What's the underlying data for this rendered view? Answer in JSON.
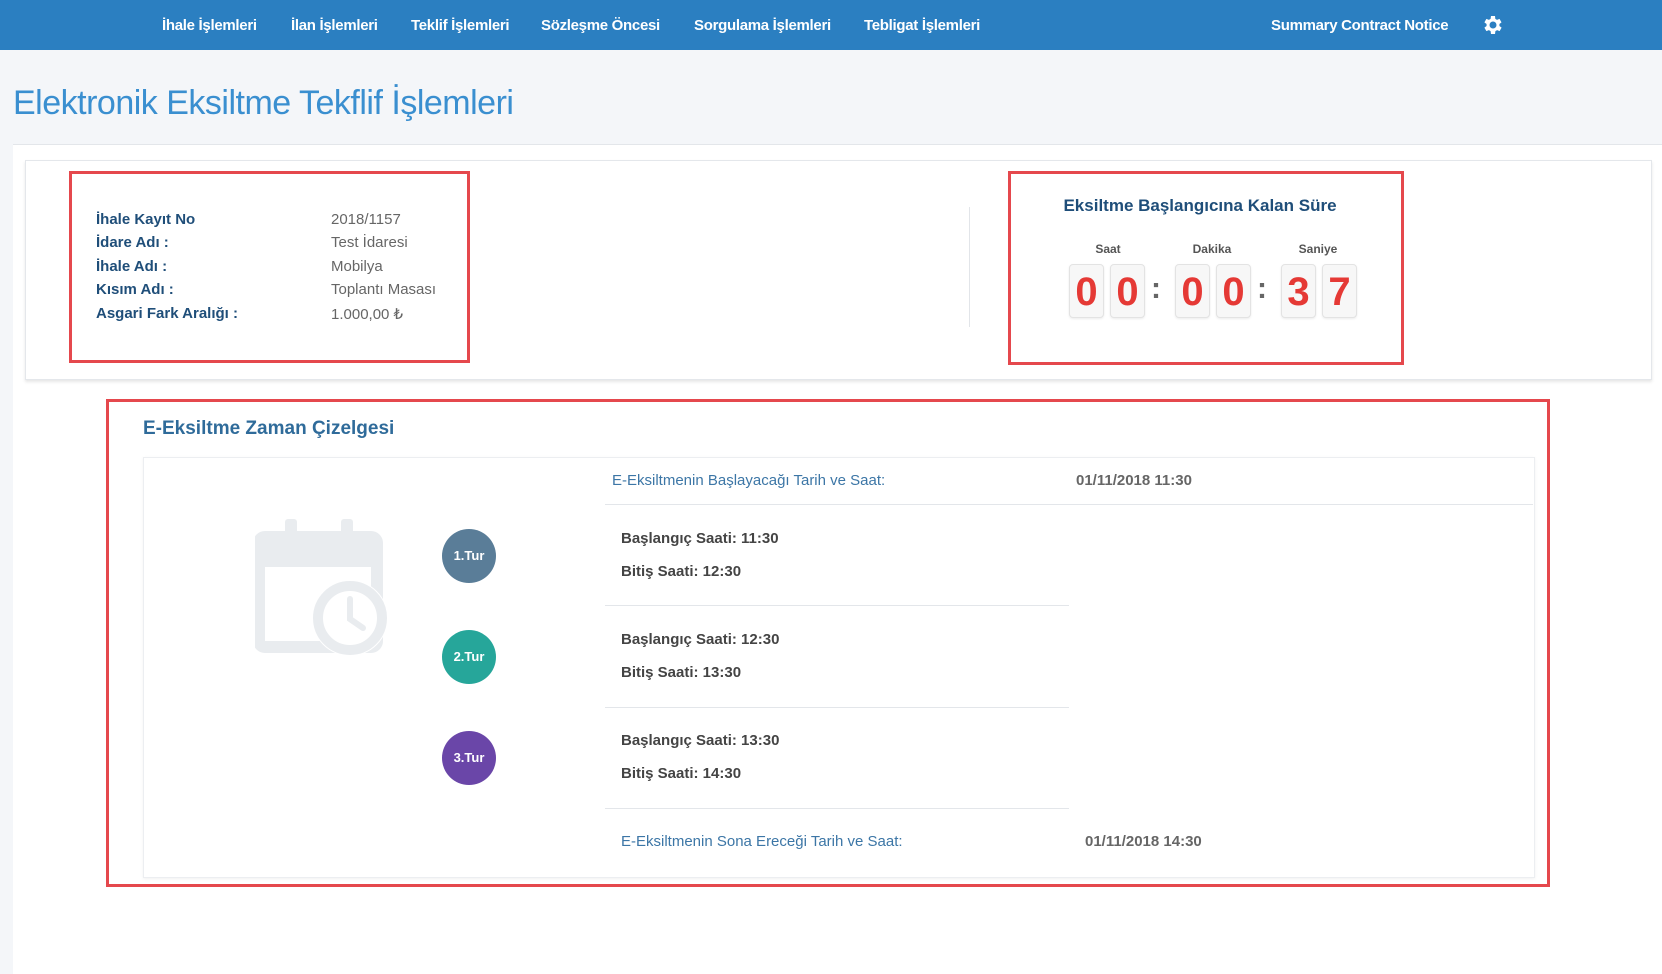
{
  "nav": {
    "items": [
      "İhale İşlemleri",
      "İlan İşlemleri",
      "Teklif İşlemleri",
      "Sözleşme Öncesi",
      "Sorgulama İşlemleri",
      "Tebligat İşlemleri"
    ],
    "right_link": "Summary Contract Notice",
    "settings_icon": "gear-icon"
  },
  "page": {
    "title": "Elektronik Eksiltme Tekflif İşlemleri"
  },
  "info": {
    "rows": [
      {
        "label": "İhale Kayıt No",
        "value": "2018/1157"
      },
      {
        "label": "İdare Adı :",
        "value": "Test İdaresi"
      },
      {
        "label": "İhale Adı :",
        "value": "Mobilya"
      },
      {
        "label": "Kısım Adı :",
        "value": "Toplantı Masası"
      },
      {
        "label": "Asgari Fark Aralığı :",
        "value": "1.000,00 ₺"
      }
    ]
  },
  "countdown": {
    "title": "Eksiltme Başlangıcına Kalan Süre",
    "labels": [
      "Saat",
      "Dakika",
      "Saniye"
    ],
    "digits": [
      "0",
      "0",
      "0",
      "0",
      "3",
      "7"
    ]
  },
  "timeline": {
    "title": "E-Eksiltme Zaman Çizelgesi",
    "start_label": "E-Eksiltmenin Başlayacağı Tarih ve Saat:",
    "start_value": "01/11/2018 11:30",
    "rounds": [
      {
        "badge": "1.Tur",
        "start": "Başlangıç Saati: 11:30",
        "end": "Bitiş Saati: 12:30"
      },
      {
        "badge": "2.Tur",
        "start": "Başlangıç Saati: 12:30",
        "end": "Bitiş Saati: 13:30"
      },
      {
        "badge": "3.Tur",
        "start": "Başlangıç Saati: 13:30",
        "end": "Bitiş Saati: 14:30"
      }
    ],
    "end_label": "E-Eksiltmenin Sona Ereceği Tarih ve Saat:",
    "end_value": "01/11/2018 14:30",
    "icon": "calendar-clock-icon"
  },
  "colors": {
    "nav_bg": "#2b7fc1",
    "title": "#3a8fd0",
    "highlight_border": "#e5484d",
    "digit": "#e53935",
    "round1": "#5a7d98",
    "round2": "#26a69a",
    "round3": "#6a46a8"
  }
}
